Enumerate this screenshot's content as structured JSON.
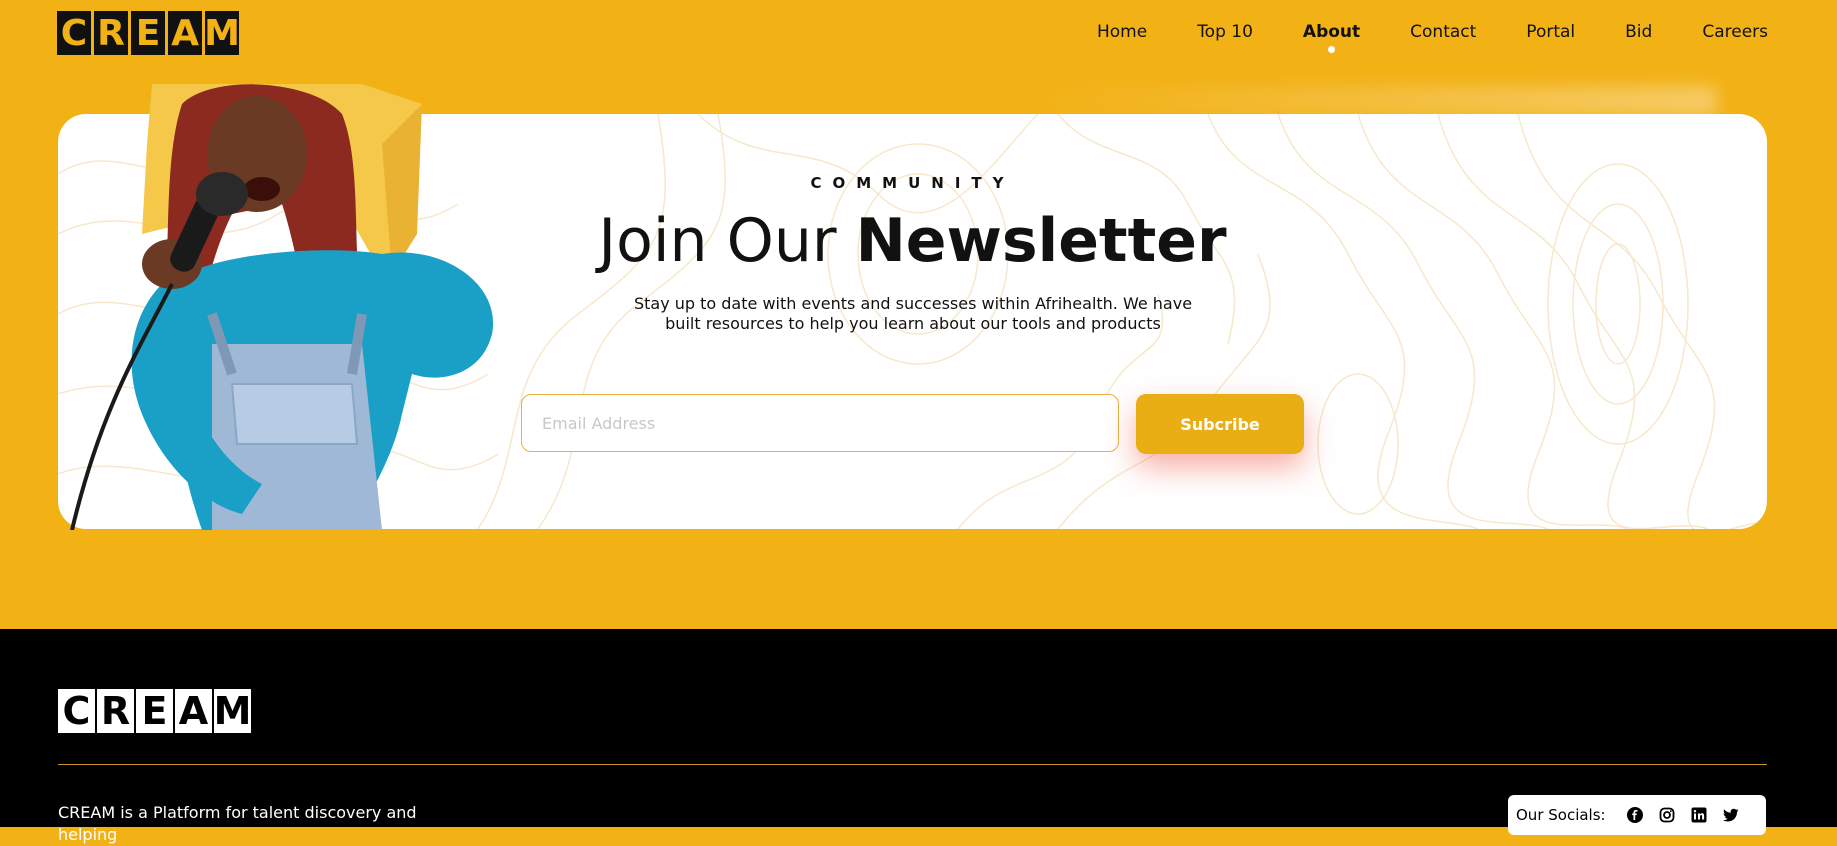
{
  "header": {
    "logo_letters": [
      "C",
      "R",
      "E",
      "A",
      "M"
    ],
    "nav": [
      {
        "label": "Home",
        "active": false
      },
      {
        "label": "Top 10",
        "active": false
      },
      {
        "label": "About",
        "active": true
      },
      {
        "label": "Contact",
        "active": false
      },
      {
        "label": "Portal",
        "active": false
      },
      {
        "label": "Bid",
        "active": false
      },
      {
        "label": "Careers",
        "active": false
      }
    ]
  },
  "newsletter": {
    "eyebrow": "COMMUNITY",
    "title_light": "Join Our ",
    "title_bold": "Newsletter",
    "description": "Stay up to date with events and successes within Afrihealth. We have built resources to help you learn about our tools and products",
    "email_placeholder": "Email Address",
    "email_value": "",
    "subscribe_label": "Subcribe"
  },
  "footer": {
    "logo_letters": [
      "C",
      "R",
      "E",
      "A",
      "M"
    ],
    "description": "CREAM is a Platform for talent discovery and helping",
    "socials_label": "Our Socials:",
    "social_icons": [
      "facebook-icon",
      "instagram-icon",
      "linkedin-icon",
      "twitter-icon"
    ]
  },
  "colors": {
    "brand_yellow": "#f2b115",
    "button_yellow": "#e8ae14",
    "black": "#000000"
  }
}
